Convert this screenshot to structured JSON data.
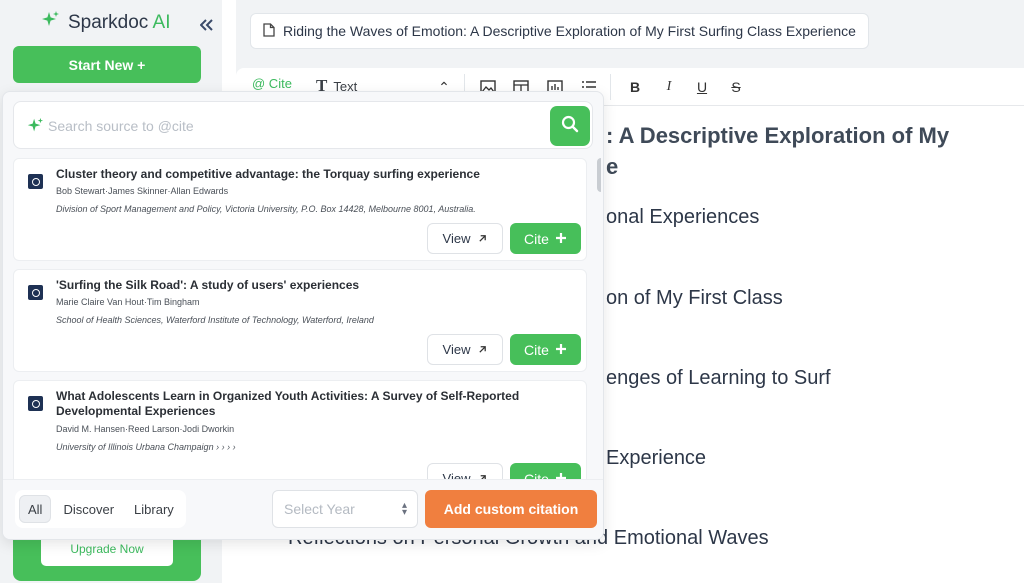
{
  "sidebar": {
    "brand": {
      "name": "Sparkdoc",
      "suffix": "AI"
    },
    "start_new": "Start New +",
    "upgrade": "Upgrade Now"
  },
  "document": {
    "title": "Riding the Waves of Emotion: A Descriptive Exploration of My First Surfing Class Experience"
  },
  "toolbar": {
    "cite": "@ Cite",
    "text_style": "Text",
    "bold": "B",
    "italic": "I",
    "underline": "U",
    "strike": "S"
  },
  "editor": {
    "headings_visible": [
      ": A Descriptive Exploration of My",
      "e",
      "onal Experiences",
      "on of My First Class",
      "enges of Learning to Surf",
      "Experience",
      "Reflections on Personal Growth and Emotional Waves"
    ]
  },
  "cite_panel": {
    "search_placeholder": "Search source to @cite",
    "results": [
      {
        "title": "Cluster theory and competitive advantage: the Torquay surfing experience",
        "authors": "Bob Stewart·James Skinner·Allan Edwards",
        "affiliation": "Division of Sport Management and Policy, Victoria University, P.O. Box 14428, Melbourne 8001, Australia.",
        "view": "View",
        "cite": "Cite"
      },
      {
        "title": "'Surfing the Silk Road': A study of users' experiences",
        "authors": "Marie Claire Van Hout·Tim Bingham",
        "affiliation": "School of Health Sciences, Waterford Institute of Technology, Waterford, Ireland",
        "view": "View",
        "cite": "Cite"
      },
      {
        "title": "What Adolescents Learn in Organized Youth Activities: A Survey of Self-Reported Developmental Experiences",
        "authors": "David M. Hansen·Reed Larson·Jodi Dworkin",
        "affiliation": "University of Illinois Urbana Champaign › › › ›",
        "view": "View",
        "cite": "Cite"
      }
    ],
    "filters": [
      "All",
      "Discover",
      "Library"
    ],
    "active_filter": "All",
    "year_placeholder": "Select Year",
    "add_custom": "Add custom citation"
  },
  "colors": {
    "brand_green": "#47bf5a",
    "accent_orange": "#f07f3f"
  }
}
